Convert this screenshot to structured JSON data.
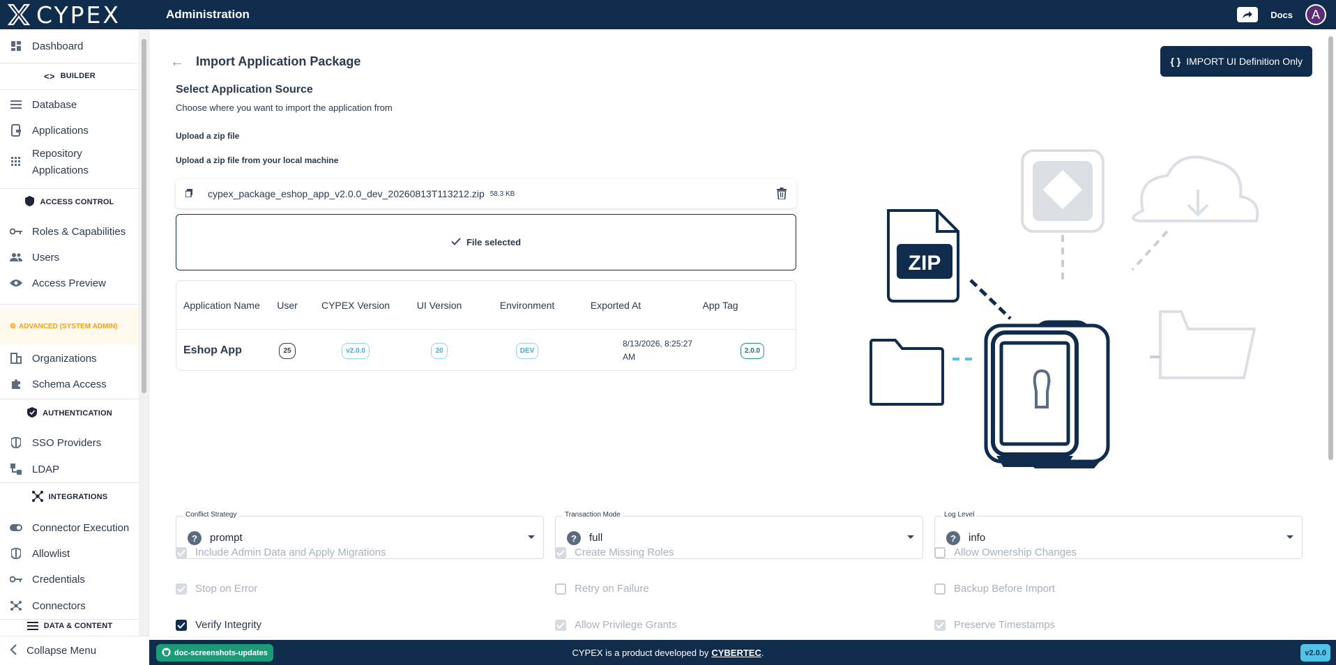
{
  "app": {
    "logo_text": "CYPEX",
    "title": "Administration",
    "docs_label": "Docs",
    "avatar_letter": "A"
  },
  "sidebar": {
    "dashboard": "Dashboard",
    "builder": "BUILDER",
    "database": "Database",
    "applications": "Applications",
    "repository_1": "Repository",
    "repository_2": "Applications",
    "access_control": "ACCESS CONTROL",
    "roles": "Roles & Capabilities",
    "users": "Users",
    "access_preview": "Access Preview",
    "advanced": "ADVANCED (SYSTEM ADMIN)",
    "organizations": "Organizations",
    "schema_access": "Schema Access",
    "authentication": "AUTHENTICATION",
    "sso": "SSO Providers",
    "ldap": "LDAP",
    "integrations": "INTEGRATIONS",
    "connector_execution": "Connector Execution",
    "allowlist": "Allowlist",
    "credentials": "Credentials",
    "connectors": "Connectors",
    "data_content": "DATA & CONTENT",
    "collapse": "Collapse Menu"
  },
  "page": {
    "title": "Import Application Package",
    "import_ui_button": "IMPORT UI Definition Only",
    "section_title": "Select Application Source",
    "section_subtitle": "Choose where you want to import the application from",
    "upload_title": "Upload a zip file",
    "upload_desc": "Upload a zip file from your local machine",
    "file_name": "cypex_package_eshop_app_v2.0.0_dev_20260813T113212.zip",
    "file_size": "58.3 KB",
    "dropzone_text": "File selected"
  },
  "app_table": {
    "headers": [
      "Application Name",
      "User",
      "CYPEX Version",
      "UI Version",
      "Environment",
      "Exported At",
      "App Tag"
    ],
    "row": {
      "name": "Eshop App",
      "user": "25",
      "cypex_version": "v2.0.0",
      "ui_version": "20",
      "environment": "DEV",
      "exported_at": "8/13/2026, 8:25:27 AM",
      "app_tag": "2.0.0"
    }
  },
  "illustration": {
    "zip_label": "ZIP"
  },
  "options": {
    "conflict": {
      "label": "Conflict Strategy",
      "value": "prompt"
    },
    "transaction": {
      "label": "Transaction Mode",
      "value": "full"
    },
    "log": {
      "label": "Log Level",
      "value": "info"
    },
    "checks": {
      "admin": "Include Admin Data and Apply Migrations",
      "roles": "Create Missing Roles",
      "ownership": "Allow Ownership Changes",
      "stop": "Stop on Error",
      "retry": "Retry on Failure",
      "backup": "Backup Before Import",
      "verify": "Verify Integrity",
      "privilege": "Allow Privilege Grants",
      "timestamps": "Preserve Timestamps"
    }
  },
  "footer": {
    "branch": "doc-screenshots-updates",
    "text": "CYPEX is a product developed by",
    "brand": "CYBERTEC",
    "version": "v2.0.0"
  },
  "colors": {
    "navy": "#0f2c4d",
    "accent": "#3ab0e0",
    "teal": "#1d9a78",
    "warning": "#f0a020"
  }
}
